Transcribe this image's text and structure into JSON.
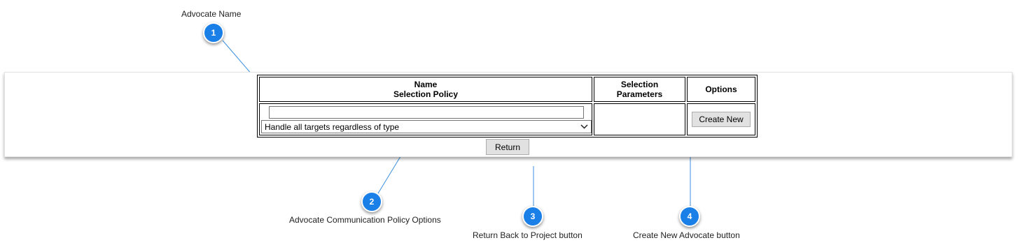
{
  "table": {
    "header_name_line1": "Name",
    "header_name_line2": "Selection Policy",
    "header_selection_line1": "Selection",
    "header_selection_line2": "Parameters",
    "header_options": "Options"
  },
  "name_input": {
    "value": ""
  },
  "policy_select": {
    "selected": "Handle all targets regardless of type"
  },
  "buttons": {
    "create_new": "Create New",
    "return": "Return"
  },
  "annotations": [
    {
      "number": "1",
      "caption": "Advocate Name"
    },
    {
      "number": "2",
      "caption": "Advocate Communication Policy Options"
    },
    {
      "number": "3",
      "caption": "Return Back to Project button"
    },
    {
      "number": "4",
      "caption": "Create New Advocate button"
    }
  ],
  "colors": {
    "badge": "#1a7fe6",
    "leader_line": "#3c8fe0"
  },
  "icons": {
    "dropdown": "chevron-down-icon"
  }
}
